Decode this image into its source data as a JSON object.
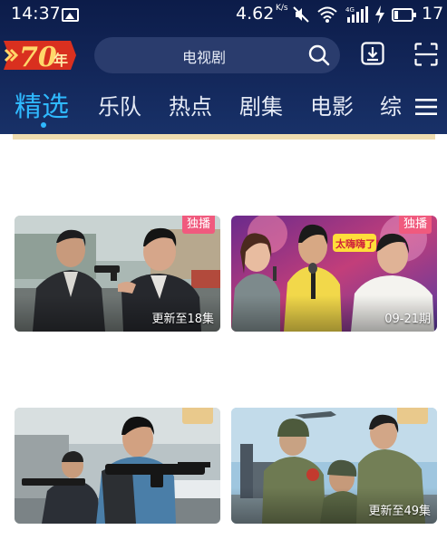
{
  "status_bar": {
    "time": "14:37",
    "network_speed": "4.62",
    "network_speed_unit": "K/s",
    "battery_level": "17"
  },
  "header": {
    "logo_text": "70年",
    "search_placeholder": "电视剧"
  },
  "tabs": [
    {
      "label": "精选",
      "active": true
    },
    {
      "label": "乐队",
      "active": false
    },
    {
      "label": "热点",
      "active": false
    },
    {
      "label": "剧集",
      "active": false
    },
    {
      "label": "电影",
      "active": false
    },
    {
      "label": "综",
      "active": false
    }
  ],
  "cards": [
    {
      "badge": "独播",
      "caption": "更新至18集"
    },
    {
      "badge": "独播",
      "caption": "09-21期",
      "overlay_tag": "太嗨嗨了!"
    },
    {
      "badge": "",
      "caption": ""
    },
    {
      "badge": "",
      "caption": "更新至49集"
    }
  ],
  "colors": {
    "header_dark": "#0c1c49",
    "tab_active": "#2fb9ff",
    "badge_pink": "#f05a7e",
    "gold": "#e9c98c"
  }
}
